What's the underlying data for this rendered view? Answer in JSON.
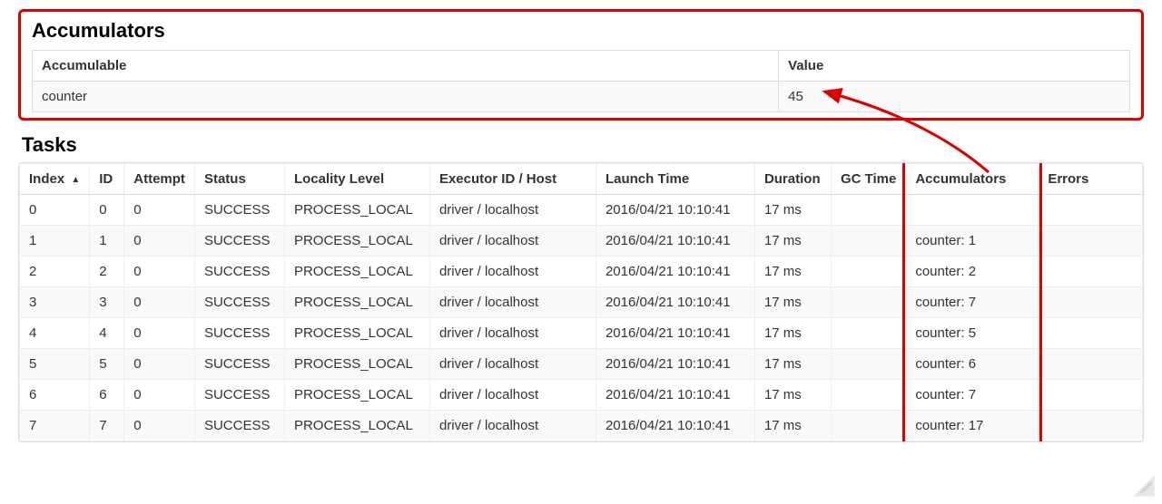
{
  "accumulators": {
    "heading": "Accumulators",
    "columns": {
      "accumulable": "Accumulable",
      "value": "Value"
    },
    "rows": [
      {
        "accumulable": "counter",
        "value": "45"
      }
    ]
  },
  "tasks": {
    "heading": "Tasks",
    "columns": {
      "index": "Index",
      "sort_indicator": "▲",
      "id": "ID",
      "attempt": "Attempt",
      "status": "Status",
      "locality": "Locality Level",
      "executor": "Executor ID / Host",
      "launch": "Launch Time",
      "duration": "Duration",
      "gc": "GC Time",
      "accumulators": "Accumulators",
      "errors": "Errors"
    },
    "rows": [
      {
        "index": "0",
        "id": "0",
        "attempt": "0",
        "status": "SUCCESS",
        "locality": "PROCESS_LOCAL",
        "executor": "driver / localhost",
        "launch": "2016/04/21 10:10:41",
        "duration": "17 ms",
        "gc": "",
        "accumulators": "",
        "errors": ""
      },
      {
        "index": "1",
        "id": "1",
        "attempt": "0",
        "status": "SUCCESS",
        "locality": "PROCESS_LOCAL",
        "executor": "driver / localhost",
        "launch": "2016/04/21 10:10:41",
        "duration": "17 ms",
        "gc": "",
        "accumulators": "counter: 1",
        "errors": ""
      },
      {
        "index": "2",
        "id": "2",
        "attempt": "0",
        "status": "SUCCESS",
        "locality": "PROCESS_LOCAL",
        "executor": "driver / localhost",
        "launch": "2016/04/21 10:10:41",
        "duration": "17 ms",
        "gc": "",
        "accumulators": "counter: 2",
        "errors": ""
      },
      {
        "index": "3",
        "id": "3",
        "attempt": "0",
        "status": "SUCCESS",
        "locality": "PROCESS_LOCAL",
        "executor": "driver / localhost",
        "launch": "2016/04/21 10:10:41",
        "duration": "17 ms",
        "gc": "",
        "accumulators": "counter: 7",
        "errors": ""
      },
      {
        "index": "4",
        "id": "4",
        "attempt": "0",
        "status": "SUCCESS",
        "locality": "PROCESS_LOCAL",
        "executor": "driver / localhost",
        "launch": "2016/04/21 10:10:41",
        "duration": "17 ms",
        "gc": "",
        "accumulators": "counter: 5",
        "errors": ""
      },
      {
        "index": "5",
        "id": "5",
        "attempt": "0",
        "status": "SUCCESS",
        "locality": "PROCESS_LOCAL",
        "executor": "driver / localhost",
        "launch": "2016/04/21 10:10:41",
        "duration": "17 ms",
        "gc": "",
        "accumulators": "counter: 6",
        "errors": ""
      },
      {
        "index": "6",
        "id": "6",
        "attempt": "0",
        "status": "SUCCESS",
        "locality": "PROCESS_LOCAL",
        "executor": "driver / localhost",
        "launch": "2016/04/21 10:10:41",
        "duration": "17 ms",
        "gc": "",
        "accumulators": "counter: 7",
        "errors": ""
      },
      {
        "index": "7",
        "id": "7",
        "attempt": "0",
        "status": "SUCCESS",
        "locality": "PROCESS_LOCAL",
        "executor": "driver / localhost",
        "launch": "2016/04/21 10:10:41",
        "duration": "17 ms",
        "gc": "",
        "accumulators": "counter: 17",
        "errors": ""
      }
    ]
  },
  "annotation": {
    "arrow_color": "#d00",
    "highlight_color": "#d00"
  }
}
